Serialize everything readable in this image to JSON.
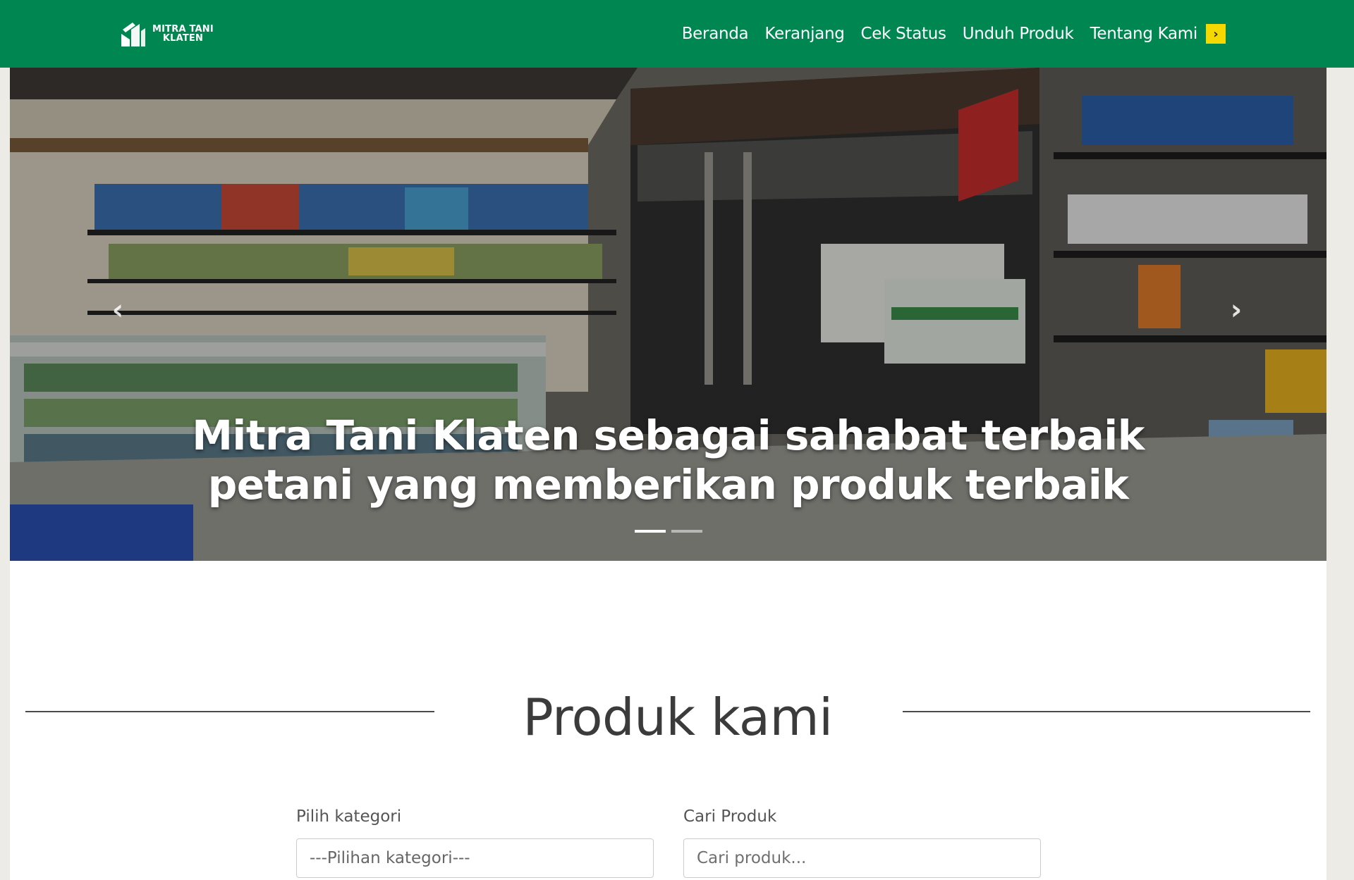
{
  "brand": {
    "logo_line1": "MITRA TANI",
    "logo_line2": "KLATEN",
    "primary_color": "#008751",
    "accent_color": "#f5d800"
  },
  "nav": {
    "items": [
      "Beranda",
      "Keranjang",
      "Cek Status",
      "Unduh Produk",
      "Tentang Kami"
    ],
    "more_icon": "chevron-right-icon"
  },
  "hero": {
    "caption_line1": "Mitra Tani Klaten sebagai sahabat terbaik",
    "caption_line2": "petani yang memberikan produk terbaik",
    "prev_icon": "chevron-left-icon",
    "next_icon": "chevron-right-icon",
    "slides_count": 2,
    "active_slide": 1
  },
  "products": {
    "title": "Produk kami",
    "category_label": "Pilih kategori",
    "category_selected": "---Pilihan kategori---",
    "search_label": "Cari Produk",
    "search_placeholder": "Cari produk..."
  }
}
